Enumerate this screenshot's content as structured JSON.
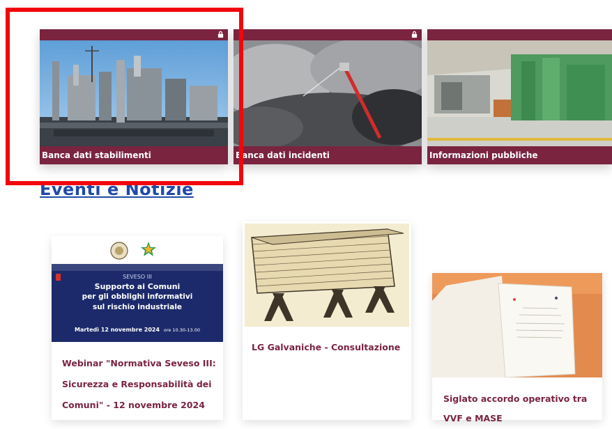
{
  "tiles": [
    {
      "label": "Banca dati stabilimenti",
      "locked": true
    },
    {
      "label": "Banca dati incidenti",
      "locked": true
    },
    {
      "label": "Informazioni pubbliche",
      "locked": false
    }
  ],
  "events_heading": "Eventi e Notizie",
  "webinar_banner": {
    "line1": "SEVESO III",
    "line2": "Supporto ai Comuni",
    "line3": "per gli obblighi informativi",
    "line4": "sul rischio industriale",
    "date_line": "Martedì 12 novembre 2024",
    "time_line": "ore 10.30-13.00"
  },
  "news": [
    {
      "title_lines": [
        "Webinar \"Normativa Seveso III:",
        "Sicurezza e Responsabilità dei",
        "Comuni\" - 12 novembre 2024"
      ]
    },
    {
      "title_lines": [
        "LG Galvaniche - Consultazione"
      ]
    },
    {
      "title_lines": [
        "Siglato accordo operativo tra",
        "VVF e MASE"
      ]
    }
  ],
  "colors": {
    "accent": "#7a2440",
    "link": "#1f4aa8",
    "highlight": "#f1060b",
    "banner_bg": "#1c2a6b"
  }
}
